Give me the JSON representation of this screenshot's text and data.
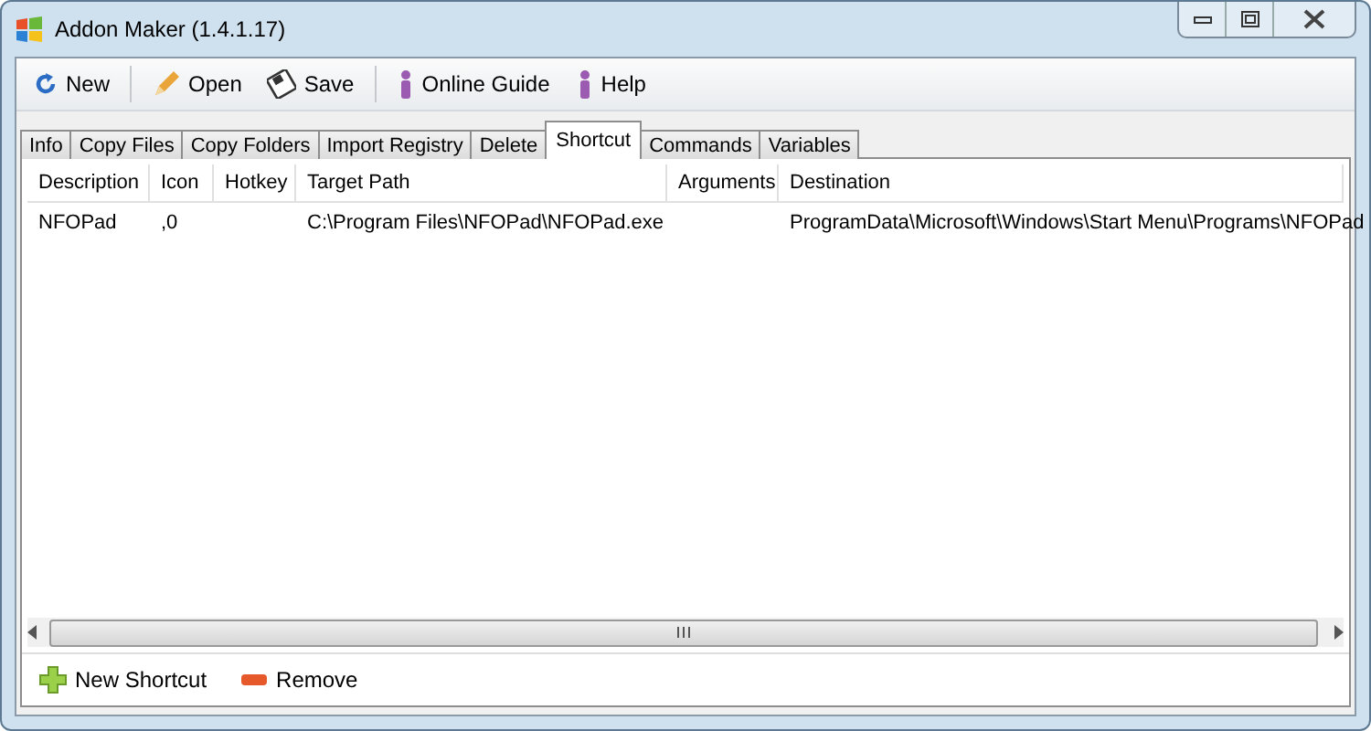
{
  "window": {
    "title": "Addon Maker (1.4.1.17)"
  },
  "toolbar": [
    {
      "kind": "new",
      "label": "New"
    },
    {
      "kind": "open",
      "label": "Open"
    },
    {
      "kind": "save",
      "label": "Save"
    },
    {
      "kind": "guide",
      "label": "Online Guide"
    },
    {
      "kind": "help",
      "label": "Help"
    }
  ],
  "tabs": [
    {
      "label": "Info",
      "selected": false
    },
    {
      "label": "Copy Files",
      "selected": false
    },
    {
      "label": "Copy Folders",
      "selected": false
    },
    {
      "label": "Import Registry",
      "selected": false
    },
    {
      "label": "Delete",
      "selected": false
    },
    {
      "label": "Shortcut",
      "selected": true
    },
    {
      "label": "Commands",
      "selected": false
    },
    {
      "label": "Variables",
      "selected": false
    }
  ],
  "table": {
    "columns": [
      "Description",
      "Icon",
      "Hotkey",
      "Target Path",
      "Arguments",
      "Destination"
    ],
    "rows": [
      [
        "NFOPad",
        ",0",
        "",
        "C:\\Program Files\\NFOPad\\NFOPad.exe",
        "",
        "ProgramData\\Microsoft\\Windows\\Start Menu\\Programs\\NFOPad"
      ]
    ]
  },
  "bottom_toolbar": [
    {
      "kind": "add",
      "label": "New Shortcut"
    },
    {
      "kind": "remove",
      "label": "Remove"
    }
  ]
}
